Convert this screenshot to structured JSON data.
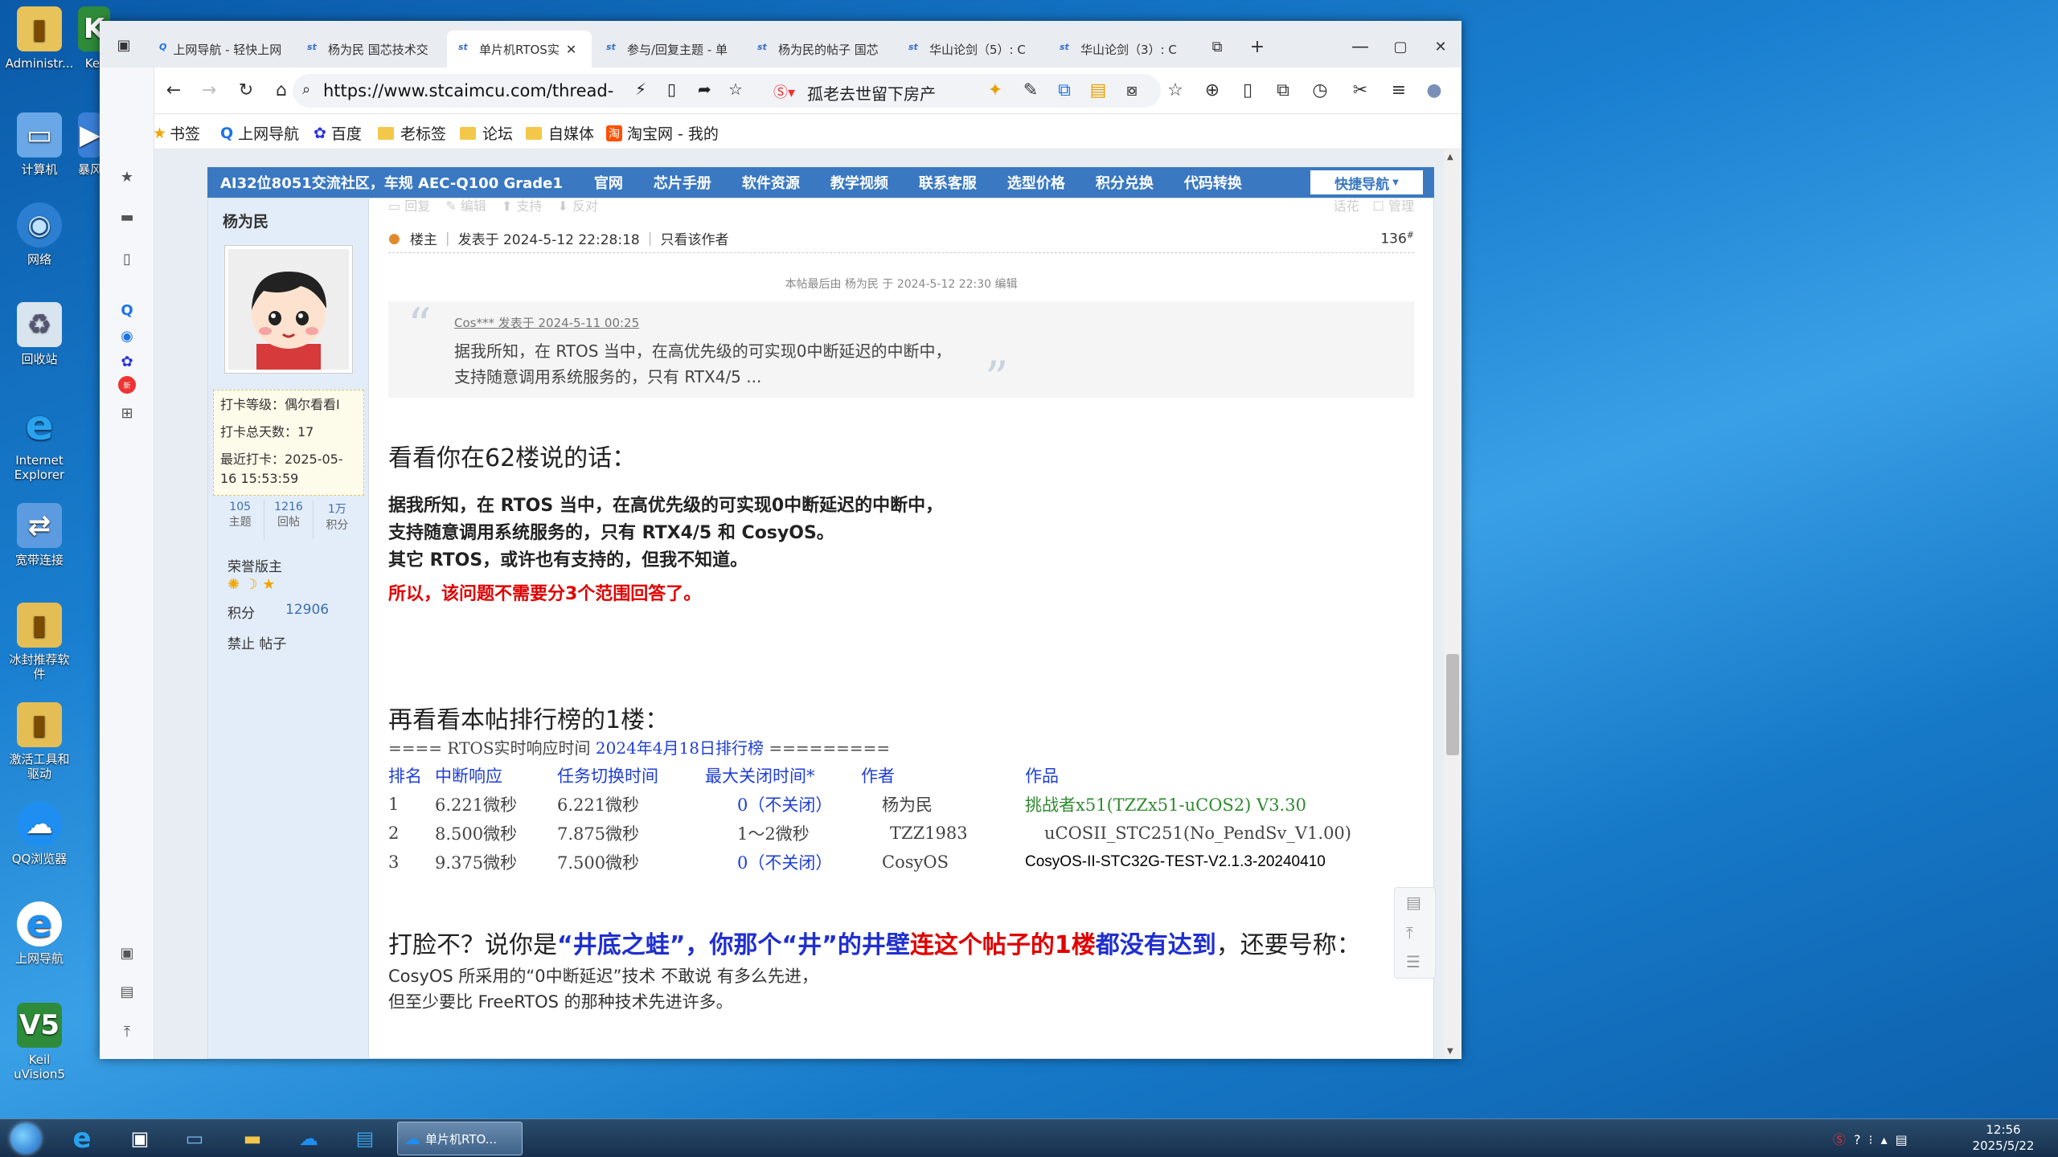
{
  "desktop": {
    "icons": [
      "Administr...",
      "计算机",
      "网络",
      "回收站",
      "Internet Explorer",
      "宽带连接",
      "冰封推荐软件",
      "激活工具和驱动",
      "QQ浏览器",
      "上网导航",
      "Keil uVision5"
    ],
    "icons2": [
      "Kei",
      "暴风"
    ]
  },
  "browser": {
    "tabs": [
      "上网导航 - 轻快上网",
      "杨为民 国芯技术交",
      "单片机RTOS实",
      "参与/回复主题 - 单",
      "杨为民的帖子 国芯",
      "华山论剑（5）: C",
      "华山论剑（3）: C"
    ],
    "url": "https://www.stcaimcu.com/thread-",
    "search_suggest": "孤老去世留下房产",
    "bookmarks": [
      "书签",
      "上网导航",
      "百度",
      "老标签",
      "论坛",
      "自媒体",
      "淘宝网 - 我的"
    ]
  },
  "site": {
    "brand": "AI32位8051交流社区，车规 AEC-Q100 Grade1",
    "nav": [
      "官网",
      "芯片手册",
      "软件资源",
      "教学视频",
      "联系客服",
      "选型价格",
      "积分兑换",
      "代码转换"
    ],
    "quicknav": "快捷导航",
    "prev_actions": [
      "回复",
      "编辑",
      "支持",
      "反对"
    ],
    "prev_right": [
      "话花",
      "管理"
    ]
  },
  "user": {
    "name": "杨为民",
    "checkin_level": "打卡等级：偶尔看看I",
    "checkin_days": "打卡总天数：17",
    "last_checkin": "最近打卡：2025-05-16 15:53:59",
    "stats": [
      {
        "v": "105",
        "l": "主题"
      },
      {
        "v": "1216",
        "l": "回帖"
      },
      {
        "v": "1万",
        "l": "积分"
      }
    ],
    "title": "荣誉版主",
    "points_label": "积分",
    "points": "12906",
    "ban": "禁止 帖子"
  },
  "post": {
    "owner": "楼主",
    "posted": "发表于 2024-5-12 22:28:18",
    "only_author": "只看该作者",
    "floor": "136",
    "floor_sup": "#",
    "edited": "本帖最后由 杨为民 于 2024-5-12 22:30 编辑",
    "quote_meta": "Cos*** 发表于 2024-5-11 00:25",
    "quote_line1": "据我所知，在 RTOS 当中，在高优先级的可实现0中断延迟的中断中，",
    "quote_line2": "支持随意调用系统服务的，只有 RTX4/5  ...",
    "h1": "看看你在62楼说的话：",
    "bold1": "据我所知，在 RTOS 当中，在高优先级的可实现0中断延迟的中断中，",
    "bold2": "支持随意调用系统服务的，只有 RTX4/5 和 CosyOS。",
    "bold3": "其它 RTOS，或许也有支持的，但我不知道。",
    "red1": "所以，该问题不需要分3个范围回答了。",
    "h2": "再看看本帖排行榜的1楼：",
    "rank_title_a": "==== RTOS实时响应时间 ",
    "rank_title_b": "2024年4月18日排行榜",
    "rank_title_c": " =========",
    "rank_headers": [
      "排名",
      "中断响应",
      "任务切换时间",
      "最大关闭时间*",
      "作者",
      "作品"
    ],
    "rank_rows": [
      [
        "1",
        "6.221微秒",
        "6.221微秒",
        "0（不关闭）",
        "杨为民",
        "挑战者x51(TZZx51-uCOS2) V3.30"
      ],
      [
        "2",
        "8.500微秒",
        "7.875微秒",
        "1～2微秒",
        "TZZ1983",
        "uCOSII_STC251(No_PendSv_V1.00)"
      ],
      [
        "3",
        "9.375微秒",
        "7.500微秒",
        "0（不关闭）",
        "CosyOS",
        "CosyOS-II-STC32G-TEST-V2.1.3-20240410"
      ]
    ],
    "slap_a": "打脸不？说你是",
    "slap_b": "“井底之蛙”，你那个“井”的井壁",
    "slap_c": "连这个帖子的1楼",
    "slap_d": "都没有达到",
    "slap_e": "，还要号称：",
    "tail1": "CosyOS 所采用的“0中断延迟”技术 不敢说 有多么先进，",
    "tail2": "但至少要比 FreeRTOS 的那种技术先进许多。"
  },
  "taskbar": {
    "active_label": "单片机RTO...",
    "time": "12:56",
    "date": "2025/5/22"
  },
  "colors": {
    "nav": "#3a78c2",
    "link": "#1f3fd6",
    "red": "#e00000",
    "bold_blue": "#1f2fd0"
  }
}
